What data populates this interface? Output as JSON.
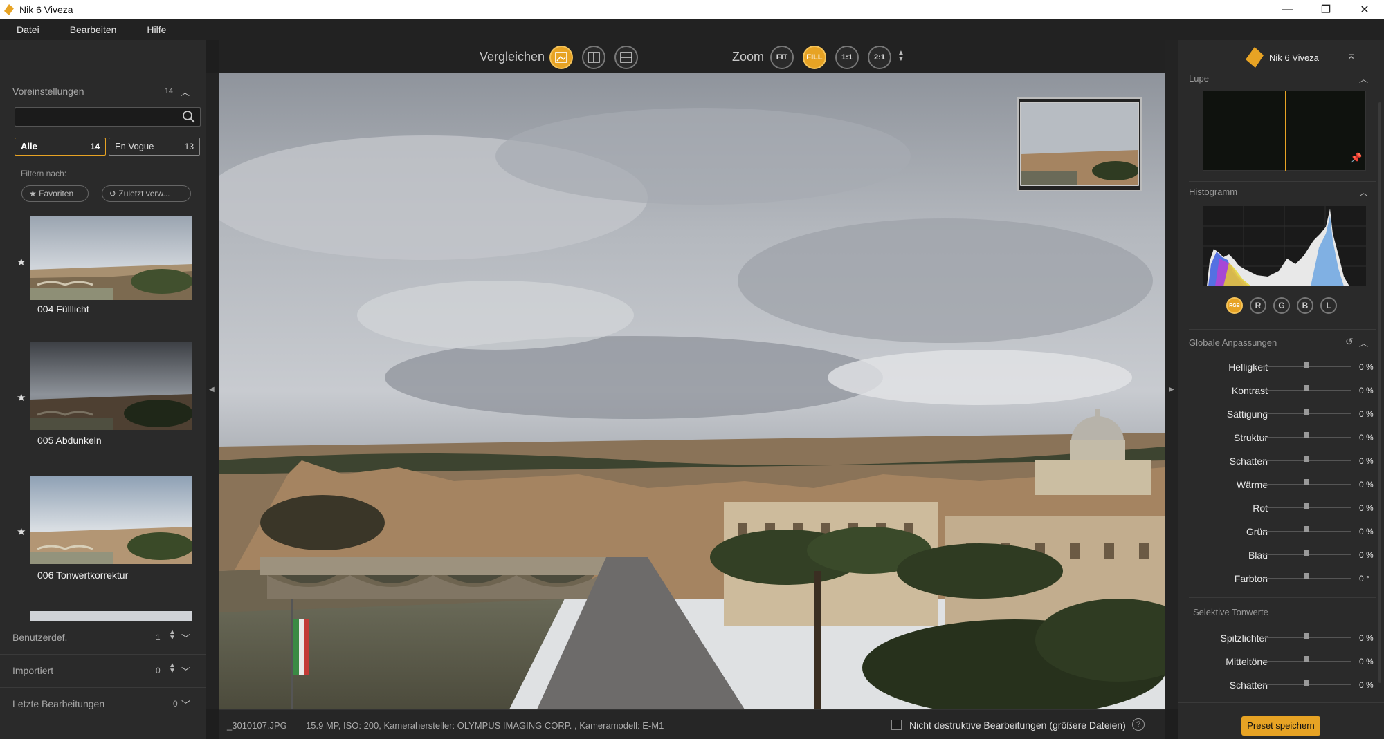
{
  "window": {
    "title": "Nik 6 Viveza"
  },
  "menu": [
    "Datei",
    "Bearbeiten",
    "Hilfe"
  ],
  "left": {
    "header": "Voreinstellungen",
    "header_count": "14",
    "search": {
      "value": "",
      "placeholder": ""
    },
    "tabs": [
      {
        "label": "Alle",
        "count": "14"
      },
      {
        "label": "En Vogue",
        "count": "13"
      }
    ],
    "filter_label": "Filtern nach:",
    "filters": [
      "Favoriten",
      "Zuletzt verw..."
    ],
    "presets": [
      {
        "name": "004 Fülllicht"
      },
      {
        "name": "005 Abdunkeln"
      },
      {
        "name": "006 Tonwertkorrektur"
      }
    ],
    "sections": [
      {
        "label": "Benutzerdef.",
        "count": "1"
      },
      {
        "label": "Importiert",
        "count": "0"
      },
      {
        "label": "Letzte Bearbeitungen",
        "count": "0"
      }
    ]
  },
  "toolbar": {
    "compare_label": "Vergleichen",
    "zoom_label": "Zoom",
    "zoom_buttons": [
      "FIT",
      "FILL",
      "1:1",
      "2:1"
    ],
    "active_zoom": "FILL"
  },
  "status": {
    "file": "_3010107.JPG",
    "info": "15.9 MP, ISO: 200, Kamerahersteller: OLYMPUS IMAGING CORP.  , Kameramodell: E-M1",
    "checkbox_label": "Nicht destruktive Bearbeitungen (größere Dateien)",
    "help": "?"
  },
  "right": {
    "title": "Nik 6 Viveza",
    "loupe_title": "Lupe",
    "histogram_title": "Histogramm",
    "channels": [
      "RGB",
      "R",
      "G",
      "B",
      "L"
    ],
    "active_channel": "RGB",
    "global_title": "Globale Anpassungen",
    "global": [
      {
        "label": "Helligkeit",
        "value": "0 %"
      },
      {
        "label": "Kontrast",
        "value": "0 %"
      },
      {
        "label": "Sättigung",
        "value": "0 %"
      },
      {
        "label": "Struktur",
        "value": "0 %"
      },
      {
        "label": "Schatten",
        "value": "0 %"
      },
      {
        "label": "Wärme",
        "value": "0 %"
      },
      {
        "label": "Rot",
        "value": "0 %"
      },
      {
        "label": "Grün",
        "value": "0 %"
      },
      {
        "label": "Blau",
        "value": "0 %"
      },
      {
        "label": "Farbton",
        "value": "0 °"
      }
    ],
    "selective_title": "Selektive Tonwerte",
    "selective": [
      {
        "label": "Spitzlichter",
        "value": "0 %"
      },
      {
        "label": "Mitteltöne",
        "value": "0 %"
      },
      {
        "label": "Schatten",
        "value": "0 %"
      }
    ],
    "save_preset": "Preset speichern"
  },
  "colors": {
    "accent": "#e7a324",
    "panel": "#2a2a2a",
    "toolbar": "#222222"
  }
}
